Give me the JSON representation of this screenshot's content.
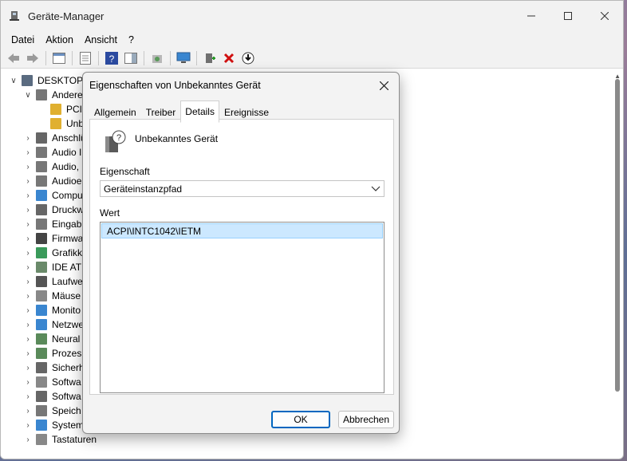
{
  "window": {
    "title": "Geräte-Manager"
  },
  "menu": [
    "Datei",
    "Aktion",
    "Ansicht",
    "?"
  ],
  "tree": {
    "root": "DESKTOP-",
    "group_open": "Andere",
    "children": [
      "PCI",
      "Unb"
    ],
    "categories": [
      "Anschlü",
      "Audio I",
      "Audio,",
      "Audioe",
      "Compu",
      "Druckw",
      "Eingab",
      "Firmwa",
      "Grafikk",
      "IDE AT",
      "Laufwe",
      "Mäuse",
      "Monito",
      "Netzwe",
      "Neural",
      "Prozes",
      "Sicherh",
      "Softwa",
      "Softwa",
      "Speich",
      "System",
      "Tastaturen"
    ]
  },
  "dialog": {
    "title": "Eigenschaften von Unbekanntes Gerät",
    "tabs": [
      "Allgemein",
      "Treiber",
      "Details",
      "Ereignisse"
    ],
    "device_name": "Unbekanntes Gerät",
    "property_label": "Eigenschaft",
    "property_value": "Geräteinstanzpfad",
    "value_label": "Wert",
    "value_item": "ACPI\\INTC1042\\IETM",
    "ok_label": "OK",
    "cancel_label": "Abbrechen"
  },
  "colors": {
    "accent": "#0067c0",
    "selection": "#cce8ff"
  }
}
